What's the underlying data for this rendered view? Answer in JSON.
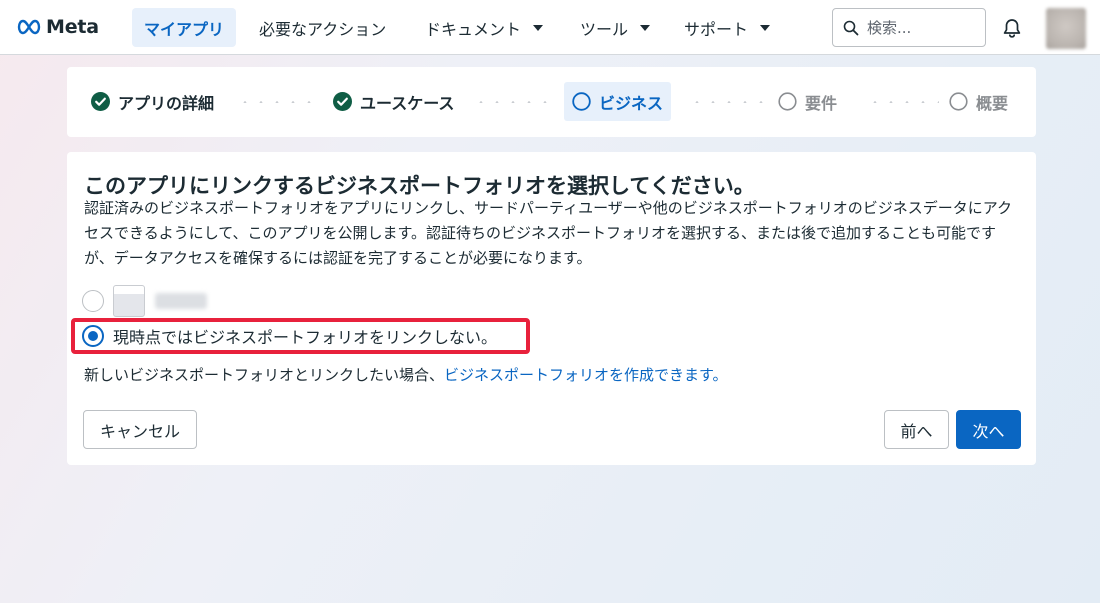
{
  "nav": {
    "logo_text": "Meta",
    "items": [
      {
        "label": "マイアプリ",
        "active": true
      },
      {
        "label": "必要なアクション"
      },
      {
        "label": "ドキュメント",
        "dropdown": true
      },
      {
        "label": "ツール",
        "dropdown": true
      },
      {
        "label": "サポート",
        "dropdown": true
      }
    ],
    "search_placeholder": "検索...",
    "icons": {
      "search": "search-icon",
      "notifications": "bell-icon",
      "avatar": "avatar"
    }
  },
  "stepper": {
    "steps": [
      {
        "label": "アプリの詳細",
        "state": "completed"
      },
      {
        "label": "ユースケース",
        "state": "completed"
      },
      {
        "label": "ビジネス",
        "state": "current"
      },
      {
        "label": "要件",
        "state": "upcoming"
      },
      {
        "label": "概要",
        "state": "upcoming"
      }
    ]
  },
  "card": {
    "title": "このアプリにリンクするビジネスポートフォリオを選択してください。",
    "description": "認証済みのビジネスポートフォリオをアプリにリンクし、サードパーティユーザーや他のビジネスポートフォリオのビジネスデータにアクセスできるようにして、このアプリを公開します。認証待ちのビジネスポートフォリオを選択する、または後で追加することも可能ですが、データアクセスを確保するには認証を完了することが必要になります。",
    "options": [
      {
        "label": "",
        "selected": false,
        "redacted": true
      },
      {
        "label": "現時点ではビジネスポートフォリオをリンクしない。",
        "selected": true
      }
    ],
    "create_text": "新しいビジネスポートフォリオとリンクしたい場合、",
    "create_link": "ビジネスポートフォリオを作成できます。",
    "buttons": {
      "cancel": "キャンセル",
      "back": "前へ",
      "next": "次へ"
    }
  },
  "colors": {
    "accent": "#0a66c2",
    "completed_check": "#0f5d45",
    "highlight_border": "#e8213c"
  }
}
